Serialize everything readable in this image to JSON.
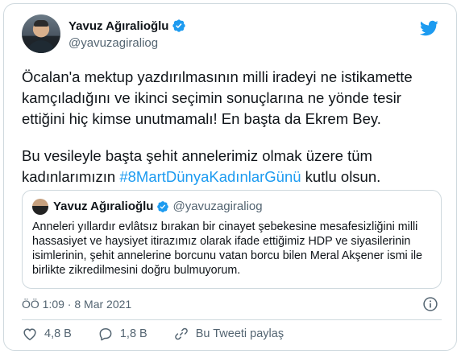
{
  "author": {
    "name": "Yavuz Ağıralioğlu",
    "handle": "@yavuzagiraliog"
  },
  "tweet": {
    "paragraph1": "Öcalan'a mektup yazdırılmasının milli iradeyi ne istikamette kamçıladığını ve ikinci seçimin sonuçlarına ne yönde tesir ettiğini hiç kimse unutmamalı! En başta da Ekrem Bey.",
    "paragraph2_before": "Bu vesileyle başta şehit annelerimiz olmak üzere tüm kadınlarımızın ",
    "hashtag": "#8MartDünyaKadınlarGünü",
    "paragraph2_after": " kutlu olsun."
  },
  "quote": {
    "name": "Yavuz Ağıralioğlu",
    "handle": "@yavuzagiraliog",
    "text": "Anneleri yıllardır evlâtsız bırakan bir cinayet şebekesine mesafesizliğini milli hassasiyet ve haysiyet itirazımız olarak ifade ettiğimiz HDP ve siyasilerinin isimlerinin, şehit annelerine borcunu vatan borcu bilen Meral Akşener ismi ile birlikte zikredilmesini doğru bulmuyorum."
  },
  "meta": {
    "timestamp": "ÖÖ 1:09 · 8 Mar 2021"
  },
  "actions": {
    "likes": "4,8 B",
    "replies": "1,8 B",
    "share_label": "Bu Tweeti paylaş"
  },
  "colors": {
    "accent": "#1d9bf0",
    "muted": "#536471",
    "text": "#0f1419",
    "border": "#cfd9de"
  },
  "icons": {
    "brand": "twitter-bird-icon",
    "verified": "verified-badge-icon",
    "info": "info-icon",
    "like": "heart-icon",
    "reply": "reply-bubble-icon",
    "share": "share-link-icon"
  }
}
